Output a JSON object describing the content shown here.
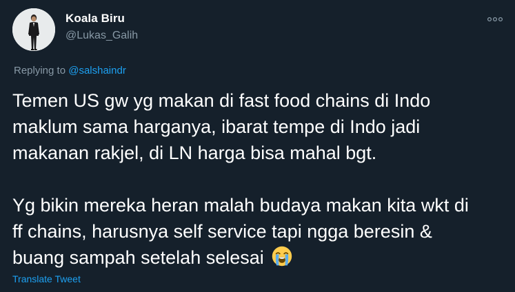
{
  "author": {
    "display_name": "Koala Biru",
    "handle": "@Lukas_Galih",
    "avatar_icon": "person-in-suit-avatar"
  },
  "more_icon": "ellipsis-icon",
  "reply": {
    "prefix": "Replying to ",
    "mention": "@salshaindr"
  },
  "tweet": {
    "paragraph1": [
      "Temen US gw yg makan di fast food chains di Indo",
      "maklum sama harganya, ibarat tempe di Indo jadi",
      "makanan rakjel, di LN harga bisa mahal bgt."
    ],
    "paragraph2": [
      "Yg bikin mereka heran malah budaya makan kita wkt di",
      "ff chains, harusnya self service tapi ngga beresin &",
      "buang sampah setelah selesai"
    ],
    "emoji": "loudly-crying-face-icon"
  },
  "translate_label": "Translate Tweet",
  "colors": {
    "background": "#15202b",
    "text": "#ffffff",
    "secondary": "#8899a6",
    "accent": "#1da1f2"
  }
}
